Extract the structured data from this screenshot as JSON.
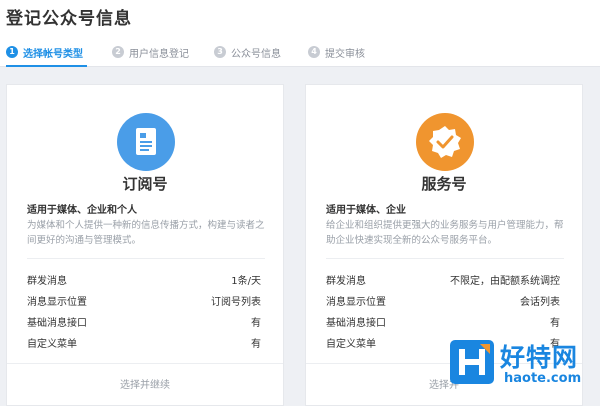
{
  "page": {
    "title": "登记公众号信息"
  },
  "steps": [
    {
      "num": "1",
      "label": "选择帐号类型",
      "active": true
    },
    {
      "num": "2",
      "label": "用户信息登记",
      "active": false
    },
    {
      "num": "3",
      "label": "公众号信息",
      "active": false
    },
    {
      "num": "4",
      "label": "提交审核",
      "active": false
    }
  ],
  "cards": [
    {
      "title": "订阅号",
      "icon": "document-icon",
      "icon_color": "#4a9de8",
      "subtitle": "适用于媒体、企业和个人",
      "description": "为媒体和个人提供一种新的信息传播方式，构建与读者之间更好的沟通与管理模式。",
      "features": [
        {
          "key": "群发消息",
          "value": "1条/天"
        },
        {
          "key": "消息显示位置",
          "value": "订阅号列表"
        },
        {
          "key": "基础消息接口",
          "value": "有"
        },
        {
          "key": "自定义菜单",
          "value": "有"
        }
      ],
      "button": "选择并继续"
    },
    {
      "title": "服务号",
      "icon": "verified-badge-icon",
      "icon_color": "#f0952f",
      "subtitle": "适用于媒体、企业",
      "description": "给企业和组织提供更强大的业务服务与用户管理能力，帮助企业快速实现全新的公众号服务平台。",
      "features": [
        {
          "key": "群发消息",
          "value": "不限定，由配额系统调控"
        },
        {
          "key": "消息显示位置",
          "value": "会话列表"
        },
        {
          "key": "基础消息接口",
          "value": "有"
        },
        {
          "key": "自定义菜单",
          "value": "有"
        }
      ],
      "button": "选择并"
    }
  ],
  "watermark": {
    "name": "好特网",
    "url": "haote.com",
    "color": "#1a86e0"
  }
}
